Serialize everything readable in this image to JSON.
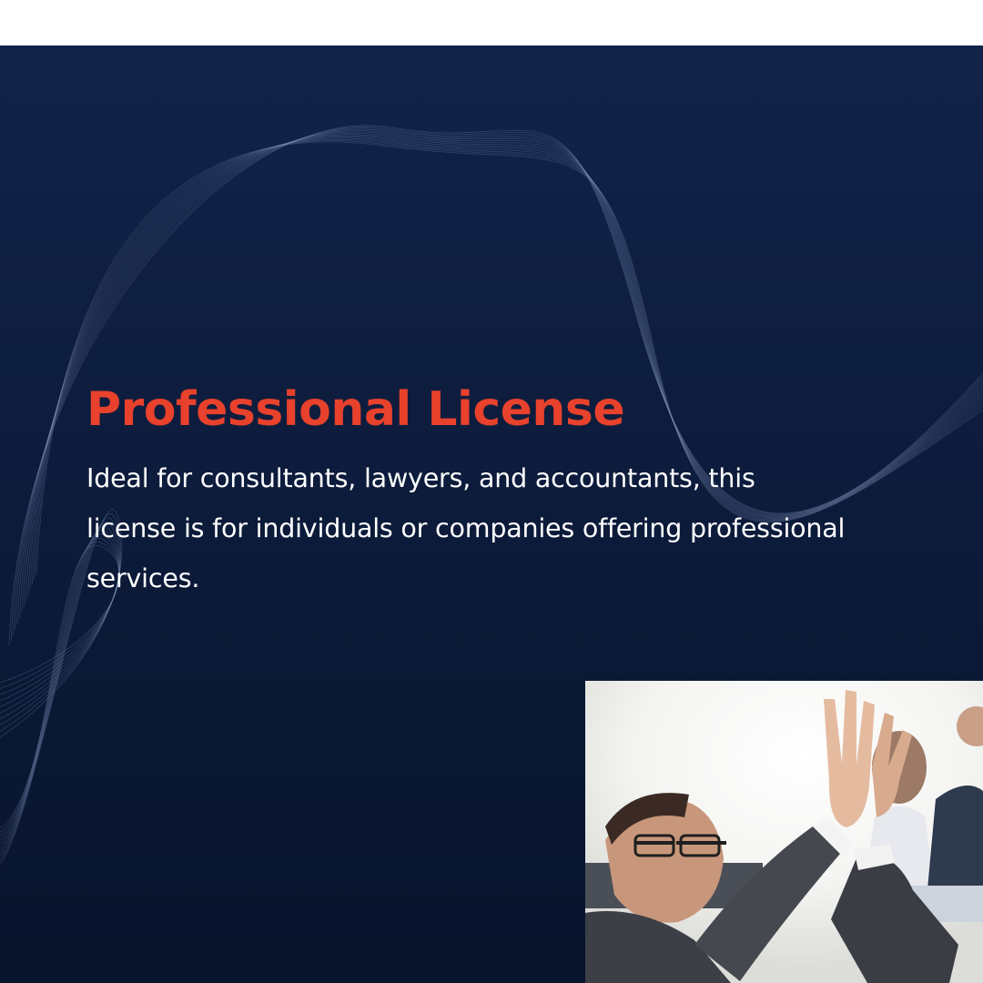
{
  "title": "Professional License",
  "description": "Ideal for consultants, lawyers, and accountants, this license is for individuals or companies offering professional services.",
  "photo": {
    "subject": "business people giving a high five"
  },
  "colors": {
    "background_top": "#12234a",
    "background_bottom": "#08142c",
    "accent": "#e8412c",
    "text": "#ffffff"
  }
}
